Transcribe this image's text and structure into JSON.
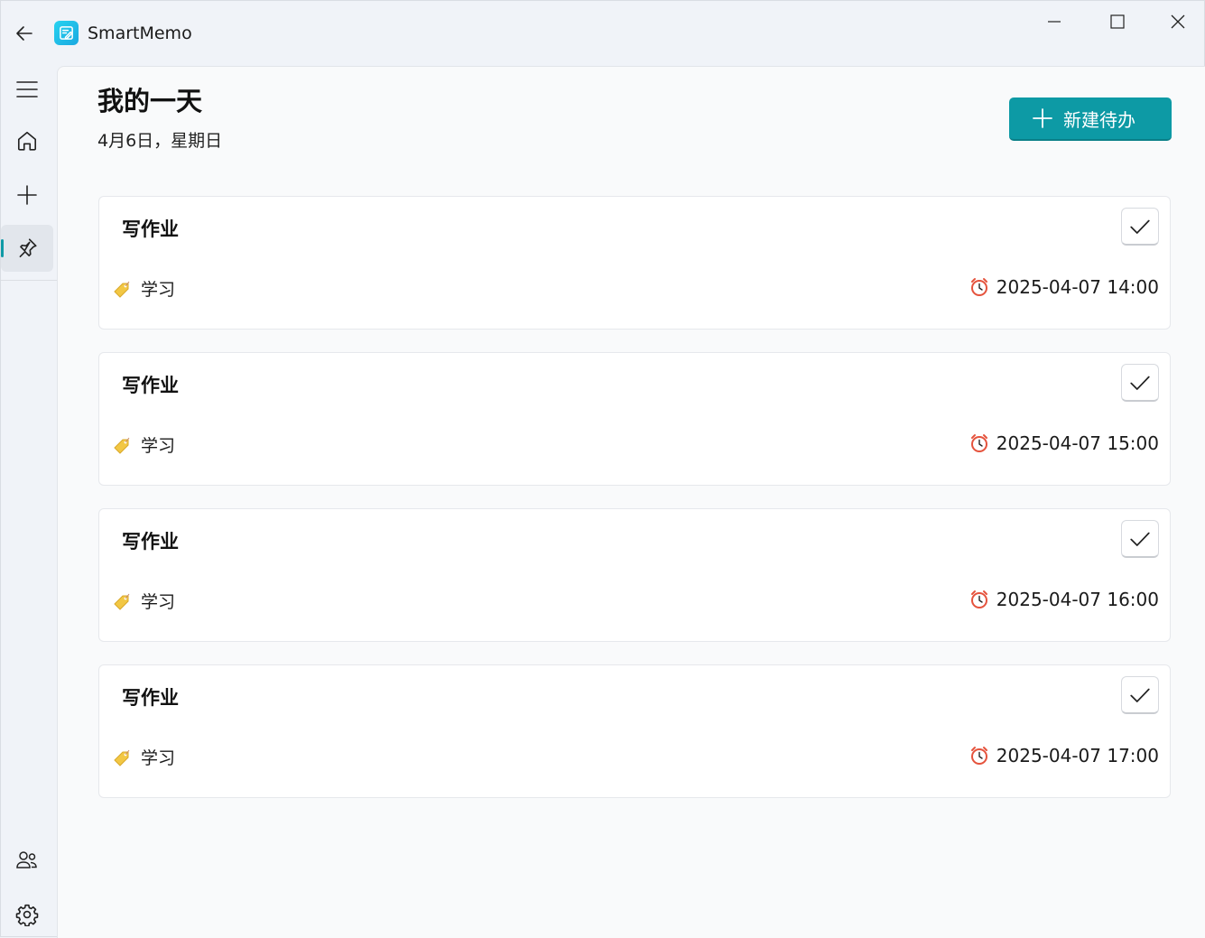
{
  "app": {
    "title": "SmartMemo",
    "accent_color": "#0d9aa5",
    "logo_color": "#27d3f0"
  },
  "titlebar": {
    "back_icon": "arrow-left-icon",
    "controls": [
      "minimize-icon",
      "maximize-icon",
      "close-icon"
    ]
  },
  "nav": {
    "items": [
      {
        "name": "menu",
        "icon": "hamburger-icon"
      },
      {
        "name": "home",
        "icon": "home-icon"
      },
      {
        "name": "add",
        "icon": "plus-icon"
      },
      {
        "name": "pinned",
        "icon": "pin-icon",
        "active": true
      }
    ],
    "footer_items": [
      {
        "name": "people",
        "icon": "people-icon"
      },
      {
        "name": "settings",
        "icon": "gear-icon"
      }
    ]
  },
  "page": {
    "title": "我的一天",
    "subtitle": "4月6日，星期日",
    "new_button_label": "新建待办"
  },
  "todos": [
    {
      "title": "写作业",
      "tag": "学习",
      "time": "2025-04-07 14:00"
    },
    {
      "title": "写作业",
      "tag": "学习",
      "time": "2025-04-07 15:00"
    },
    {
      "title": "写作业",
      "tag": "学习",
      "time": "2025-04-07 16:00"
    },
    {
      "title": "写作业",
      "tag": "学习",
      "time": "2025-04-07 17:00"
    }
  ]
}
